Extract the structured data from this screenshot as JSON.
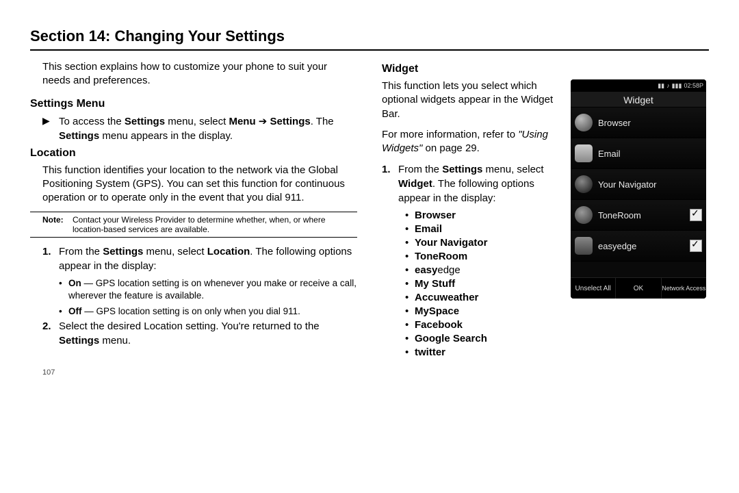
{
  "section_title": "Section 14: Changing Your Settings",
  "intro": "This section explains how to customize your phone to suit your needs and preferences.",
  "settings_menu": {
    "heading": "Settings Menu",
    "step_pre": "To access the ",
    "step_bold1": "Settings",
    "step_mid1": " menu, select ",
    "step_bold2": "Menu",
    "step_arrow": " ➔ ",
    "step_bold3": "Settings",
    "step_mid2": ". The ",
    "step_bold4": "Settings",
    "step_post": " menu appears in the display."
  },
  "location": {
    "heading": "Location",
    "para": "This function identifies your location to the network via the Global Positioning System (GPS). You can set this function for continuous operation or to operate only in the event that you dial 911.",
    "note_label": "Note:",
    "note_body": "Contact your Wireless Provider to determine whether, when, or where location-based services are available.",
    "step1_a": "From the ",
    "step1_b": "Settings",
    "step1_c": " menu, select ",
    "step1_d": "Location",
    "step1_e": ". The following options appear in the display:",
    "sub1_b": "On",
    "sub1_t": " — GPS location setting is on whenever you make or receive a call, wherever the feature is available.",
    "sub2_b": "Off",
    "sub2_t": " — GPS location setting is on only when you dial 911.",
    "step2_a": "Select the desired Location setting. You're returned to the ",
    "step2_b": "Settings",
    "step2_c": " menu."
  },
  "widget": {
    "heading": "Widget",
    "para1": "This function lets you select which optional widgets appear in the Widget Bar.",
    "para2_a": "For more information, refer to ",
    "para2_i": "\"Using Widgets\"",
    "para2_b": "  on page 29.",
    "step1_a": "From the ",
    "step1_b": "Settings",
    "step1_c": " menu, select ",
    "step1_d": "Widget",
    "step1_e": ". The following options appear in the display:",
    "bullets": [
      "Browser",
      "Email",
      "Your Navigator",
      "ToneRoom",
      "easy",
      "My Stuff",
      "Accuweather",
      "MySpace",
      "Facebook",
      "Google Search",
      "twitter"
    ],
    "bullet5_suffix": "edge"
  },
  "phone": {
    "status_time": "02:58P",
    "title": "Widget",
    "items": [
      {
        "label": "Browser",
        "checked": false
      },
      {
        "label": "Email",
        "checked": false
      },
      {
        "label": "Your Navigator",
        "checked": false
      },
      {
        "label": "ToneRoom",
        "checked": true
      },
      {
        "label": "easyedge",
        "checked": true
      }
    ],
    "soft_left": "Unselect All",
    "soft_mid": "OK",
    "soft_right": "Network Access"
  },
  "page_number": "107"
}
